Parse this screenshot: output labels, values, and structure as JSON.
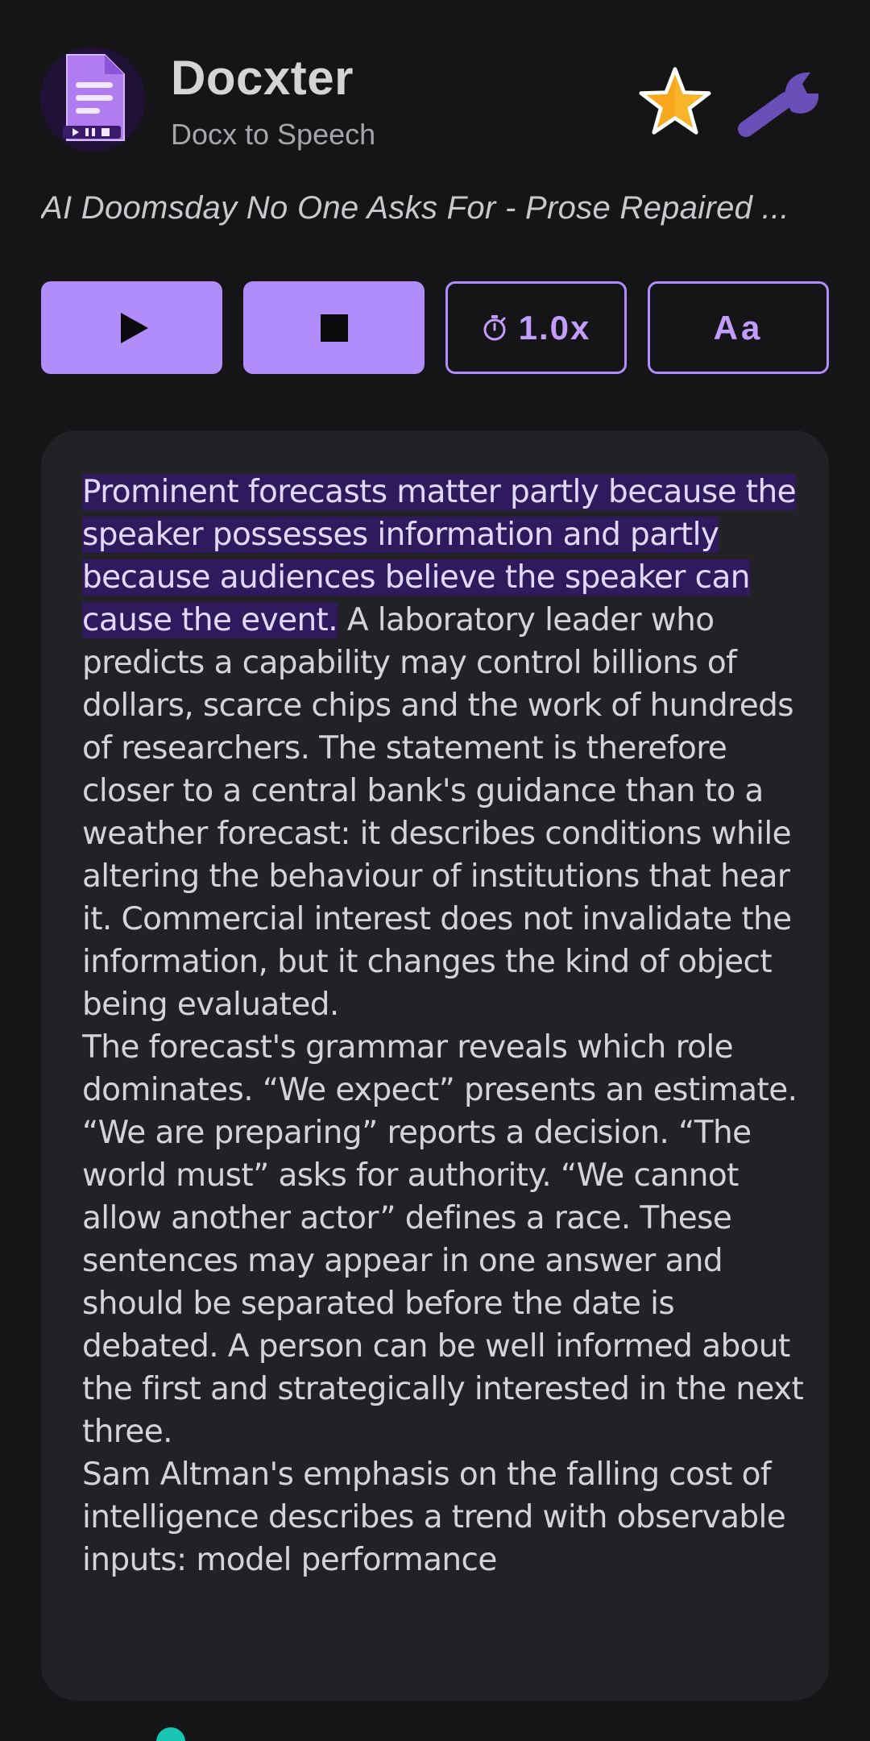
{
  "app": {
    "title": "Docxter",
    "subtitle": "Docx to Speech",
    "icon": "document-icon"
  },
  "header_actions": {
    "favorite_icon": "star-icon",
    "settings_icon": "wrench-icon"
  },
  "document": {
    "title": "AI Doomsday No One Asks For - Prose Repaired ..."
  },
  "controls": {
    "play_icon": "play-icon",
    "stop_icon": "stop-icon",
    "speed_icon": "stopwatch-icon",
    "speed_label": "1.0x",
    "font_label": "Aa"
  },
  "reader": {
    "highlighted": "Prominent forecasts matter partly because the speaker possesses information and partly because audiences believe the speaker can cause the event.",
    "p1_rest": " A laboratory leader who predicts a capability may control billions of dollars, scarce chips and the work of hundreds of researchers. The statement is therefore closer to a central bank's guidance than to a weather forecast: it describes conditions while altering the behaviour of institutions that hear it. Commercial interest does not invalidate the information, but it changes the kind of object being evaluated.",
    "p2": "The forecast's grammar reveals which role dominates. “We expect” presents an estimate. “We are preparing” reports a decision. “The world must” asks for authority. “We cannot allow another actor” defines a race. These sentences may appear in one answer and should be separated before the date is debated. A person can be well informed about the first and strategically interested in the next three.",
    "p3": "Sam Altman's emphasis on the falling cost of intelligence describes a trend with observable inputs: model performance"
  },
  "colors": {
    "background": "#151517",
    "accent": "#b18cfb",
    "panel": "#212126",
    "highlight": "#2e1a5c",
    "scroll_indicator": "#19c6b4"
  }
}
